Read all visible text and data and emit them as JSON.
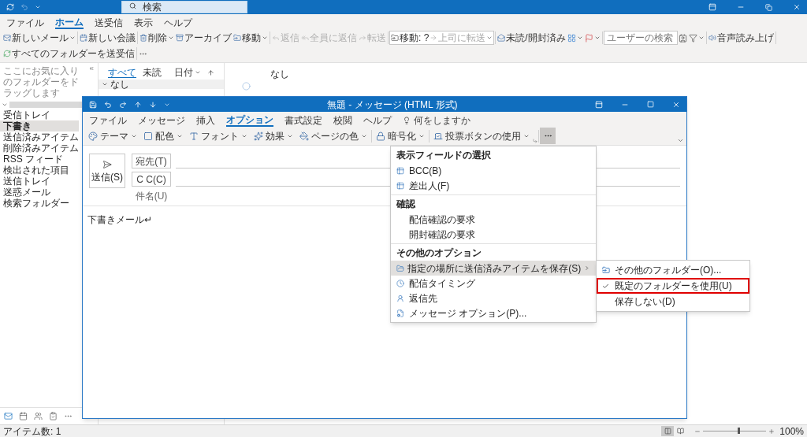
{
  "title_bar": {
    "search_placeholder": "検索"
  },
  "menu_tabs": [
    {
      "label": "ファイル",
      "selected": false
    },
    {
      "label": "ホーム",
      "selected": true
    },
    {
      "label": "送受信",
      "selected": false
    },
    {
      "label": "表示",
      "selected": false
    },
    {
      "label": "ヘルプ",
      "selected": false
    }
  ],
  "ribbon": {
    "groups": [
      [
        {
          "kind": "button",
          "label": "新しいメール",
          "dropdown": true,
          "disabled": false
        }
      ],
      [
        {
          "kind": "button",
          "label": "新しい会議",
          "dropdown": false,
          "disabled": false
        }
      ],
      [
        {
          "kind": "button",
          "label": "削除",
          "dropdown": true,
          "disabled": false
        },
        {
          "kind": "button",
          "label": "アーカイブ",
          "dropdown": false,
          "disabled": false
        },
        {
          "kind": "button",
          "label": "移動",
          "dropdown": true,
          "disabled": false
        }
      ],
      [
        {
          "kind": "button",
          "label": "返信",
          "dropdown": false,
          "disabled": true
        },
        {
          "kind": "button",
          "label": "全員に返信",
          "dropdown": false,
          "disabled": true
        },
        {
          "kind": "button",
          "label": "転送",
          "dropdown": false,
          "disabled": true
        }
      ],
      [
        {
          "kind": "quick_steps",
          "steps": [
            {
              "label": "移動: ?",
              "disabled": false
            },
            {
              "label": "上司に転送",
              "disabled": true
            }
          ]
        }
      ],
      [
        {
          "kind": "button",
          "label": "未読/開封済み",
          "dropdown": false,
          "disabled": false
        },
        {
          "kind": "icon",
          "dropdown": true,
          "disabled": false
        },
        {
          "kind": "icon",
          "dropdown": true,
          "disabled": false
        }
      ],
      [
        {
          "kind": "field",
          "placeholder": "ユーザーの検索"
        },
        {
          "kind": "icon",
          "dropdown": false,
          "disabled": false
        },
        {
          "kind": "icon",
          "dropdown": true,
          "disabled": false
        }
      ],
      [
        {
          "kind": "button",
          "label": "音声読み上げ",
          "dropdown": false,
          "disabled": false
        }
      ],
      [
        {
          "kind": "button",
          "label": "すべてのフォルダーを送受信",
          "dropdown": false,
          "disabled": false
        }
      ],
      [
        {
          "kind": "icon",
          "dropdown": false,
          "disabled": false
        }
      ]
    ]
  },
  "folder_pane": {
    "favorites_hint": "ここにお気に入りのフォルダーをドラッグします",
    "folders": [
      {
        "label": "受信トレイ",
        "selected": false
      },
      {
        "label": "下書き",
        "selected": true
      },
      {
        "label": "送信済みアイテム",
        "selected": false
      },
      {
        "label": "削除済みアイテム",
        "selected": false
      },
      {
        "label": "RSS フィード",
        "selected": false
      },
      {
        "label": "検出された項目",
        "selected": false
      },
      {
        "label": "送信トレイ",
        "selected": false
      },
      {
        "label": "迷惑メール",
        "selected": false
      },
      {
        "label": "検索フォルダー",
        "selected": false
      }
    ]
  },
  "message_list": {
    "filters": [
      {
        "label": "すべて",
        "selected": true
      },
      {
        "label": "未読",
        "selected": false
      }
    ],
    "sort": "日付",
    "group": "なし"
  },
  "reading_pane": {
    "text": "なし"
  },
  "nav_bar": [
    {
      "selected": true
    },
    {
      "selected": false
    },
    {
      "selected": false
    },
    {
      "selected": false
    },
    {
      "selected": false
    }
  ],
  "status_bar": {
    "text": "アイテム数: 1",
    "views": [
      {
        "selected": true
      },
      {
        "selected": false
      }
    ],
    "zoom": {
      "level": 0.55,
      "reading": "100%"
    }
  },
  "compose": {
    "title": "無題 - メッセージ (HTML 形式)",
    "tabs": [
      {
        "label": "ファイル",
        "selected": false
      },
      {
        "label": "メッセージ",
        "selected": false
      },
      {
        "label": "挿入",
        "selected": false
      },
      {
        "label": "オプション",
        "selected": true
      },
      {
        "label": "書式設定",
        "selected": false
      },
      {
        "label": "校閲",
        "selected": false
      },
      {
        "label": "ヘルプ",
        "selected": false
      }
    ],
    "tell_me": "何をしますか",
    "ribbon": {
      "groups": [
        [
          {
            "label": "テーマ",
            "dropdown": true
          },
          {
            "label": "配色",
            "dropdown": true
          },
          {
            "label": "フォント",
            "dropdown": true
          },
          {
            "label": "効果",
            "dropdown": true
          },
          {
            "label": "ページの色",
            "dropdown": true
          }
        ],
        [
          {
            "label": "暗号化",
            "dropdown": true
          }
        ],
        [
          {
            "label": "投票ボタンの使用",
            "dropdown": true
          }
        ]
      ],
      "more_pressed": true
    },
    "header": {
      "send": "送信(S)",
      "to": "宛先(T)",
      "cc": "C C(C)",
      "subject": "件名(U)"
    },
    "body": "下書きメール↵",
    "menu": {
      "sections": [
        {
          "heading": "表示フィールドの選択",
          "items": [
            {
              "label": "BCC(B)",
              "highlighted": false
            },
            {
              "label": "差出人(F)",
              "highlighted": false
            }
          ]
        },
        {
          "heading": "確認",
          "items": [
            {
              "label": "配信確認の要求",
              "highlighted": false
            },
            {
              "label": "開封確認の要求",
              "highlighted": false
            }
          ]
        },
        {
          "heading": "その他のオプション",
          "items": [
            {
              "label": "指定の場所に送信済みアイテムを保存(S)",
              "highlighted": true,
              "submenu": [
                {
                  "label": "その他のフォルダー(O)...",
                  "checked": false,
                  "marked": false
                },
                {
                  "label": "既定のフォルダーを使用(U)",
                  "checked": true,
                  "marked": true
                },
                {
                  "label": "保存しない(D)",
                  "checked": false,
                  "marked": false
                }
              ]
            },
            {
              "label": "配信タイミング",
              "highlighted": false
            },
            {
              "label": "返信先",
              "highlighted": false
            },
            {
              "label": "メッセージ オプション(P)...",
              "highlighted": false
            }
          ]
        }
      ]
    }
  }
}
